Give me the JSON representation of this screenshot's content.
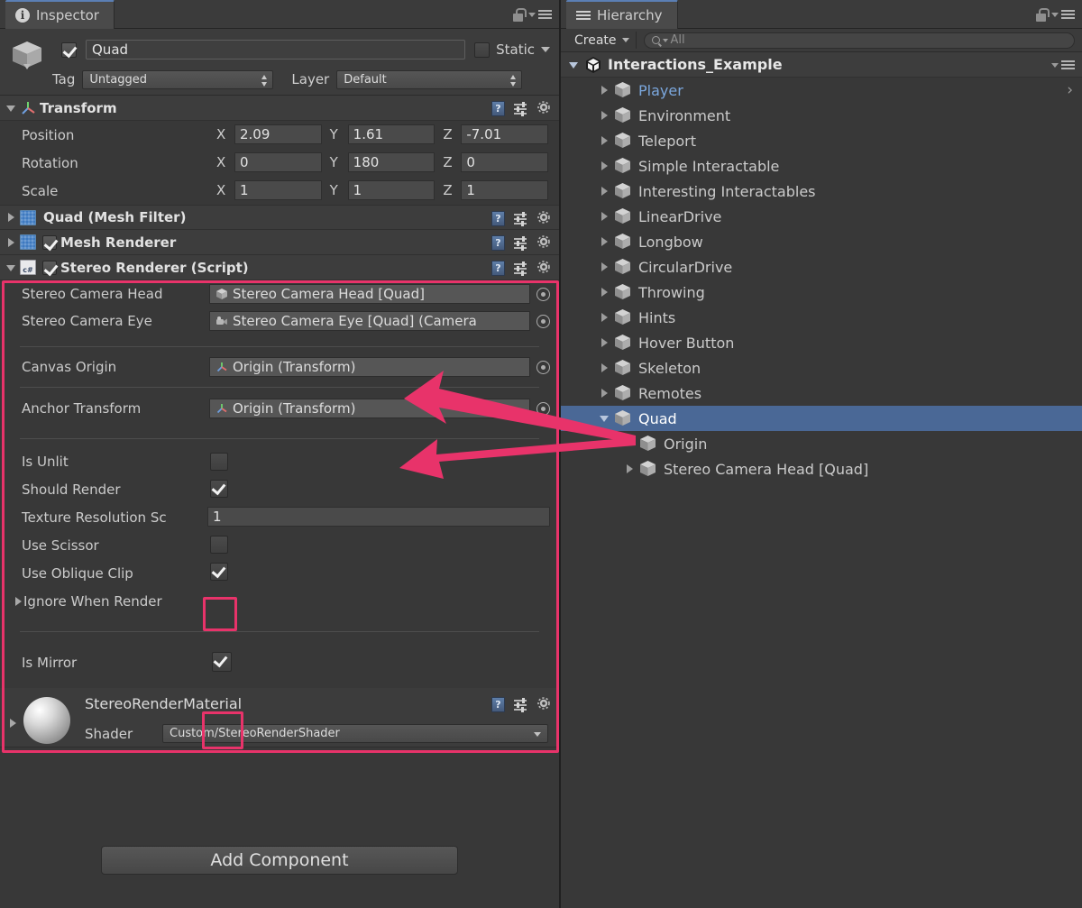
{
  "inspector": {
    "tab_label": "Inspector",
    "tab_icon": "info-icon",
    "lock_icon": "lock-icon",
    "menu_icon": "hamburger-menu-icon",
    "object": {
      "enabled": true,
      "name": "Quad",
      "static_label": "Static",
      "static_checked": false,
      "tag_label": "Tag",
      "tag_value": "Untagged",
      "layer_label": "Layer",
      "layer_value": "Default"
    },
    "transform": {
      "title": "Transform",
      "expanded": true,
      "rows": [
        {
          "label": "Position",
          "x": "2.09",
          "y": "1.61",
          "z": "-7.01"
        },
        {
          "label": "Rotation",
          "x": "0",
          "y": "180",
          "z": "0"
        },
        {
          "label": "Scale",
          "x": "1",
          "y": "1",
          "z": "1"
        }
      ],
      "axes": [
        "X",
        "Y",
        "Z"
      ]
    },
    "mesh_filter": {
      "title": "Quad (Mesh Filter)",
      "expanded": false
    },
    "mesh_renderer": {
      "title": "Mesh Renderer",
      "expanded": false,
      "enabled": true
    },
    "stereo_renderer": {
      "title": "Stereo Renderer (Script)",
      "expanded": true,
      "enabled": true,
      "object_fields": [
        {
          "label": "Stereo Camera Head",
          "value": "Stereo Camera Head [Quad]",
          "icon": "cube-icon"
        },
        {
          "label": "Stereo Camera Eye",
          "value": "Stereo Camera Eye [Quad] (Camera",
          "icon": "camera-icon"
        },
        {
          "label": "Canvas Origin",
          "value": "Origin (Transform)",
          "icon": "transform-icon"
        },
        {
          "label": "Anchor Transform",
          "value": "Origin (Transform)",
          "icon": "transform-icon"
        }
      ],
      "toggles": [
        {
          "label": "Is Unlit",
          "checked": false
        },
        {
          "label": "Should Render",
          "checked": true
        }
      ],
      "texture_resolution": {
        "label": "Texture Resolution Sc",
        "value": "1"
      },
      "toggles2": [
        {
          "label": "Use Scissor",
          "checked": false,
          "highlighted": true
        },
        {
          "label": "Use Oblique Clip",
          "checked": true,
          "highlighted": false
        }
      ],
      "ignore_when_render": {
        "label": "Ignore When Render"
      },
      "is_mirror": {
        "label": "Is Mirror",
        "checked": true,
        "highlighted": true
      }
    },
    "material": {
      "name": "StereoRenderMaterial",
      "shader_label": "Shader",
      "shader_value": "Custom/StereoRenderShader"
    },
    "add_component_label": "Add Component"
  },
  "hierarchy": {
    "tab_label": "Hierarchy",
    "tab_icon": "list-icon",
    "create_label": "Create",
    "search_placeholder": "All",
    "root": {
      "label": "Interactions_Example",
      "expanded": true,
      "icon": "unity-logo-icon"
    },
    "items": [
      {
        "label": "Player",
        "indent": 1,
        "arrow": "closed",
        "prefab": true,
        "selected": false,
        "chevron": true
      },
      {
        "label": "Environment",
        "indent": 1,
        "arrow": "closed",
        "prefab": false,
        "selected": false,
        "chevron": false
      },
      {
        "label": "Teleport",
        "indent": 1,
        "arrow": "closed",
        "prefab": false,
        "selected": false,
        "chevron": false
      },
      {
        "label": "Simple Interactable",
        "indent": 1,
        "arrow": "closed",
        "prefab": false,
        "selected": false,
        "chevron": false
      },
      {
        "label": "Interesting Interactables",
        "indent": 1,
        "arrow": "closed",
        "prefab": false,
        "selected": false,
        "chevron": false
      },
      {
        "label": "LinearDrive",
        "indent": 1,
        "arrow": "closed",
        "prefab": false,
        "selected": false,
        "chevron": false
      },
      {
        "label": "Longbow",
        "indent": 1,
        "arrow": "closed",
        "prefab": false,
        "selected": false,
        "chevron": false
      },
      {
        "label": "CircularDrive",
        "indent": 1,
        "arrow": "closed",
        "prefab": false,
        "selected": false,
        "chevron": false
      },
      {
        "label": "Throwing",
        "indent": 1,
        "arrow": "closed",
        "prefab": false,
        "selected": false,
        "chevron": false
      },
      {
        "label": "Hints",
        "indent": 1,
        "arrow": "closed",
        "prefab": false,
        "selected": false,
        "chevron": false
      },
      {
        "label": "Hover Button",
        "indent": 1,
        "arrow": "closed",
        "prefab": false,
        "selected": false,
        "chevron": false
      },
      {
        "label": "Skeleton",
        "indent": 1,
        "arrow": "closed",
        "prefab": false,
        "selected": false,
        "chevron": false
      },
      {
        "label": "Remotes",
        "indent": 1,
        "arrow": "closed",
        "prefab": false,
        "selected": false,
        "chevron": false
      },
      {
        "label": "Quad",
        "indent": 1,
        "arrow": "open",
        "prefab": false,
        "selected": true,
        "chevron": false
      },
      {
        "label": "Origin",
        "indent": 2,
        "arrow": "none",
        "prefab": false,
        "selected": false,
        "chevron": false
      },
      {
        "label": "Stereo Camera Head [Quad]",
        "indent": 2,
        "arrow": "closed",
        "prefab": false,
        "selected": false,
        "chevron": false
      }
    ]
  },
  "annotations": {
    "highlight_color": "#e8336a",
    "arrow_color": "#e8336a",
    "arrows": [
      {
        "name": "arrow-to-canvas-origin",
        "from": "hierarchy-origin",
        "to": "canvas-origin-field"
      },
      {
        "name": "arrow-to-anchor-transform",
        "from": "hierarchy-origin",
        "to": "anchor-transform-field"
      }
    ],
    "outlines": [
      "stereo-renderer-component",
      "use-scissor-checkbox",
      "is-mirror-checkbox"
    ]
  }
}
